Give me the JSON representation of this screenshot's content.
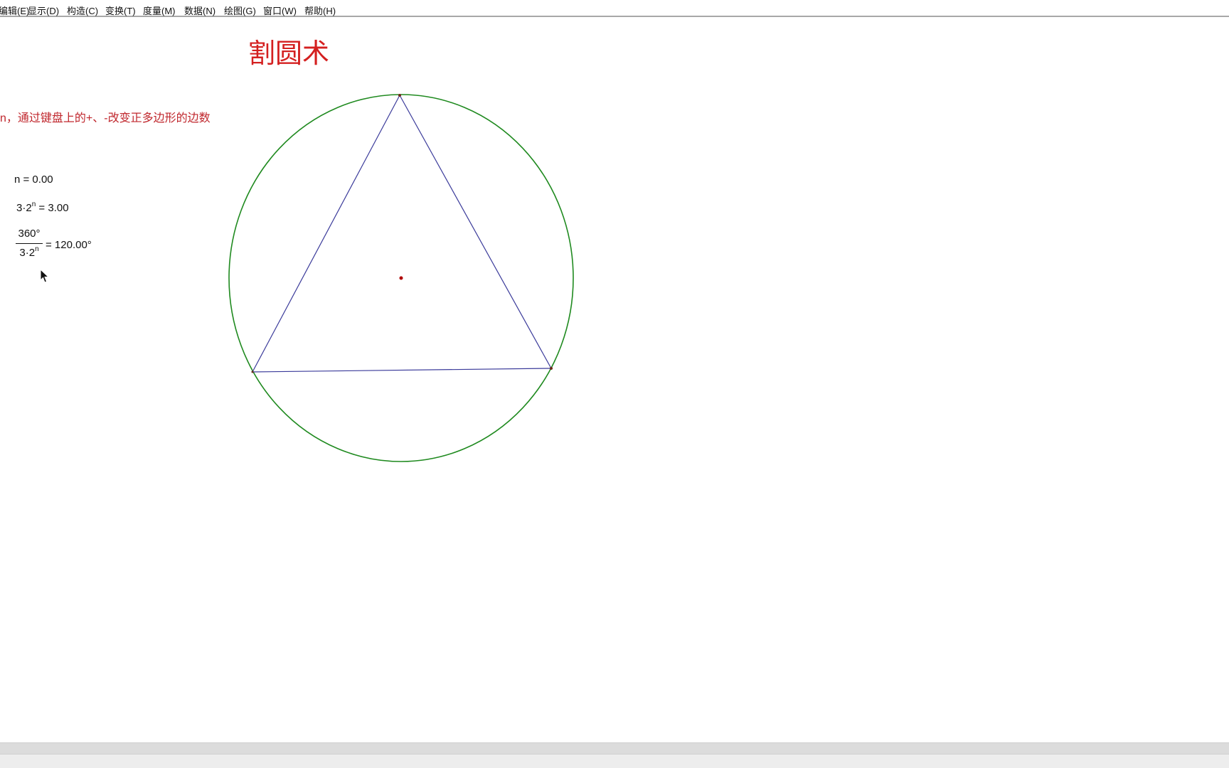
{
  "menu": {
    "items": [
      {
        "label": "编辑(E)"
      },
      {
        "label": "显示(D)"
      },
      {
        "label": "构造(C)"
      },
      {
        "label": "变换(T)"
      },
      {
        "label": "度量(M)"
      },
      {
        "label": "数据(N)"
      },
      {
        "label": "绘图(G)"
      },
      {
        "label": "窗口(W)"
      },
      {
        "label": "帮助(H)"
      }
    ]
  },
  "sketch": {
    "title": "割圆术",
    "instruction": "n，通过键盘上的+、-改变正多边形的边数",
    "measurements": {
      "n_label": "n = 0.00",
      "sides_base": "3·2",
      "sides_exp": "n",
      "sides_value": " = 3.00",
      "angle_numerator": "360°",
      "angle_den_base": "3·2",
      "angle_den_exp": "n",
      "angle_value": "= 120.00°"
    }
  },
  "colors": {
    "title": "#d42020",
    "instruction": "#c0272d",
    "circle": "#1f8a1f",
    "polygon": "#3a3a9a",
    "point": "#8b0000"
  },
  "icons": {
    "cursor": "mouse-pointer-icon"
  }
}
